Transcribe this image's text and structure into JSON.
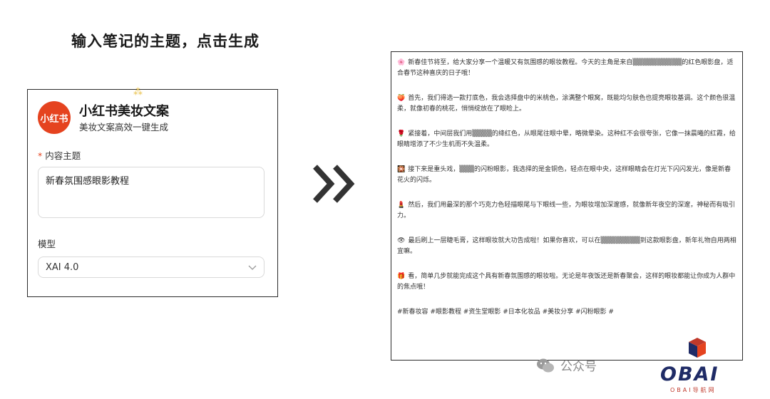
{
  "heading": "输入笔记的主题，点击生成",
  "app": {
    "logo_text": "小红书",
    "title": "小红书美妆文案",
    "subtitle": "美妆文案高效一键生成"
  },
  "form": {
    "required_mark": "*",
    "topic_label": "内容主题",
    "topic_value": "新春氛围感眼影教程",
    "model_label": "模型",
    "model_value": "XAI 4.0"
  },
  "output": {
    "paragraphs": [
      {
        "emoji": "🌸",
        "text": "新春佳节将至，给大家分享一个温暖又有氛围感的眼妆教程。今天的主角是来自▒▒▒▒▒▒▒▒▒▒的红色眼影盘，适合春节这种喜庆的日子哦！"
      },
      {
        "emoji": "🍑",
        "text": "首先，我们得选一款打底色，我会选择盘中的米桃色，涂满整个眼窝，既能均匀肤色也提亮眼妆基调。这个颜色很温柔，就像初春的桃花，悄悄绽放在了眼睑上。"
      },
      {
        "emoji": "🌹",
        "text": "紧接着，中间层我们用▒▒▒▒的绛红色，从眼尾往眼中晕，略微晕染。这种红不会很夸张，它像一抹晨曦的红霞，给眼睛增添了不少生机而不失温柔。"
      },
      {
        "emoji": "🎇",
        "text": "接下来是重头戏，▒▒▒的闪粉眼影，我选择的是金铜色，轻点在眼中央，这样眼睛会在灯光下闪闪发光，像是新春花火的闪烁。"
      },
      {
        "emoji": "💄",
        "text": "然后，我们用最深的那个巧克力色轻描眼尾与下眼线一些，为眼妆增加深邃感，就像新年夜空的深邃，神秘而有吸引力。"
      },
      {
        "emoji": "👁",
        "text": "最后刷上一层睫毛膏，这样眼妆就大功告成啦！如果你喜欢，可以在▒▒▒▒▒▒▒▒到这款眼影盘，新年礼物自用两相宜嘛。"
      },
      {
        "emoji": "🎁",
        "text": "看，简单几步就能完成这个具有新春氛围感的眼妆啦。无论是年夜饭还是新春聚会，这样的眼妆都能让你成为人群中的焦点哦！"
      }
    ],
    "tags": "#新春妆容 #眼影教程 #资生堂眼影 #日本化妆品 #美妆分享 #闪粉眼影 #"
  },
  "watermark": {
    "text": "公众号",
    "brand": "OBAI",
    "brand_sub": "OBAI导航网"
  },
  "colors": {
    "accent": "#e5431f",
    "brand_navy": "#1f2b66",
    "brand_red": "#c0392b"
  }
}
